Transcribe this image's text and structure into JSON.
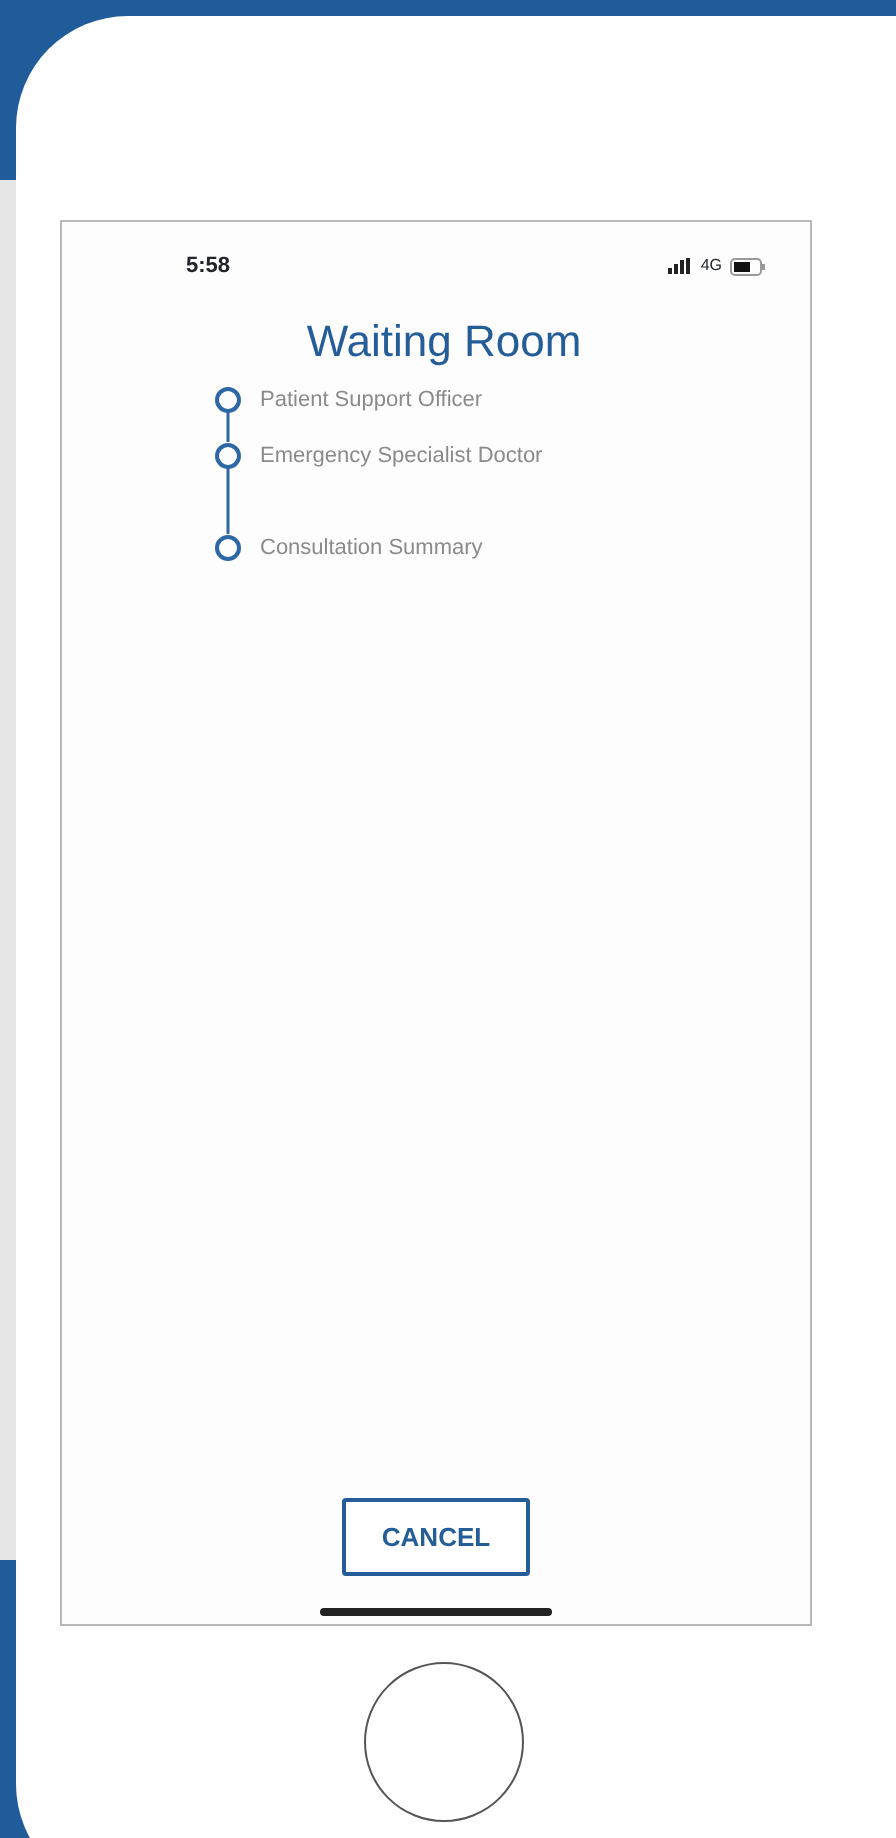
{
  "status_bar": {
    "time": "5:58",
    "network": "4G"
  },
  "title": "Waiting Room",
  "steps": [
    {
      "label": "Patient Support Officer"
    },
    {
      "label": "Emergency Specialist Doctor"
    },
    {
      "label": "Consultation Summary"
    }
  ],
  "cancel_button": "CANCEL"
}
